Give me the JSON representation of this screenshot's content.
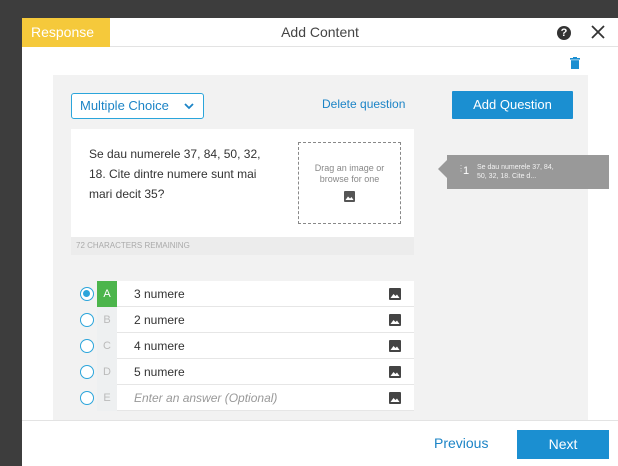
{
  "header": {
    "tab_label": "Response",
    "title": "Add Content",
    "help_glyph": "?"
  },
  "question": {
    "type_label": "Multiple Choice",
    "delete_label": "Delete question",
    "text_lines": [
      "Se dau numerele 37, 84, 50, 32,",
      "18. Cite dintre numere sunt mai",
      "mari decit 35?"
    ],
    "dropzone_lines": [
      "Drag an image or",
      "browse for one"
    ],
    "chars_remaining": "72 CHARACTERS REMAINING"
  },
  "answers": [
    {
      "letter": "A",
      "text": "3 numere",
      "selected": true
    },
    {
      "letter": "B",
      "text": "2 numere",
      "selected": false
    },
    {
      "letter": "C",
      "text": "4 numere",
      "selected": false
    },
    {
      "letter": "D",
      "text": "5 numere",
      "selected": false
    },
    {
      "letter": "E",
      "text": "",
      "placeholder": "Enter an answer (Optional)",
      "selected": false
    }
  ],
  "sidebar": {
    "add_question_label": "Add Question",
    "items": [
      {
        "number": "1",
        "preview_lines": [
          "Se dau numerele 37, 84,",
          "50, 32, 18. Cite d..."
        ]
      }
    ]
  },
  "footer": {
    "previous_label": "Previous",
    "next_label": "Next"
  },
  "colors": {
    "accent_yellow": "#f5c93b",
    "primary_blue": "#1b8fd1",
    "correct_green": "#4cb54c"
  }
}
